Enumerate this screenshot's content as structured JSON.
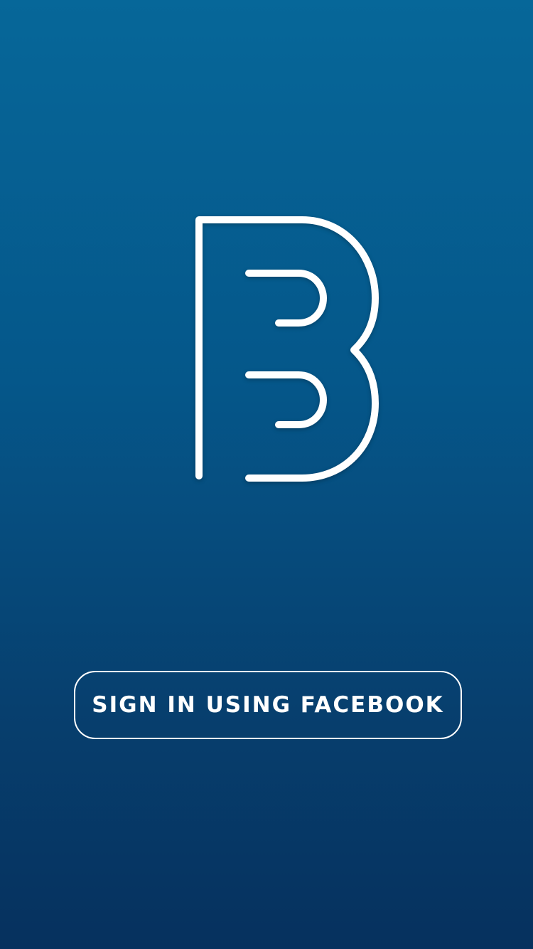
{
  "brand": {
    "logo_icon": "letter-b-logo-icon",
    "logo_color": "#ffffff"
  },
  "background": {
    "gradient_top": "#066799",
    "gradient_bottom": "#06315e"
  },
  "auth": {
    "facebook_button_label": "SIGN IN USING FACEBOOK"
  }
}
